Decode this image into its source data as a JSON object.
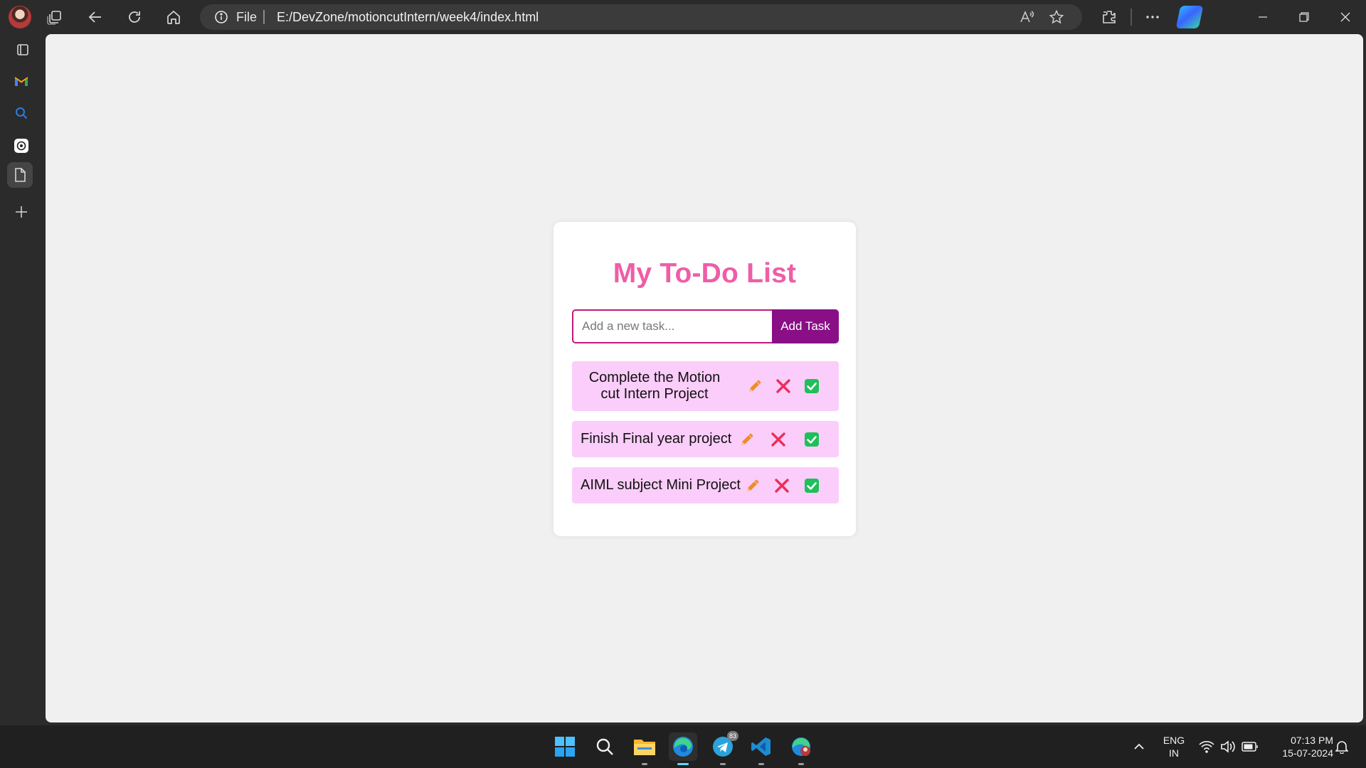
{
  "browser": {
    "address": {
      "scheme_label": "File",
      "url": "E:/DevZone/motioncutIntern/week4/index.html"
    }
  },
  "app": {
    "title": "My To-Do List",
    "input": {
      "placeholder": "Add a new task...",
      "value": ""
    },
    "add_button_label": "Add Task",
    "tasks": [
      {
        "text": "Complete the Motion cut Intern Project"
      },
      {
        "text": "Finish Final year project"
      },
      {
        "text": "AIML subject Mini Project"
      }
    ],
    "colors": {
      "title": "#ee5ea7",
      "button": "#8a0f86",
      "task_bg": "#fbcdfa",
      "edit_icon": "#f08a2c",
      "delete_icon": "#e8305a",
      "complete_icon": "#1fbf5a"
    }
  },
  "taskbar": {
    "telegram_badge": "83",
    "language": {
      "line1": "ENG",
      "line2": "IN"
    },
    "clock": {
      "time": "07:13 PM",
      "date": "15-07-2024"
    }
  }
}
